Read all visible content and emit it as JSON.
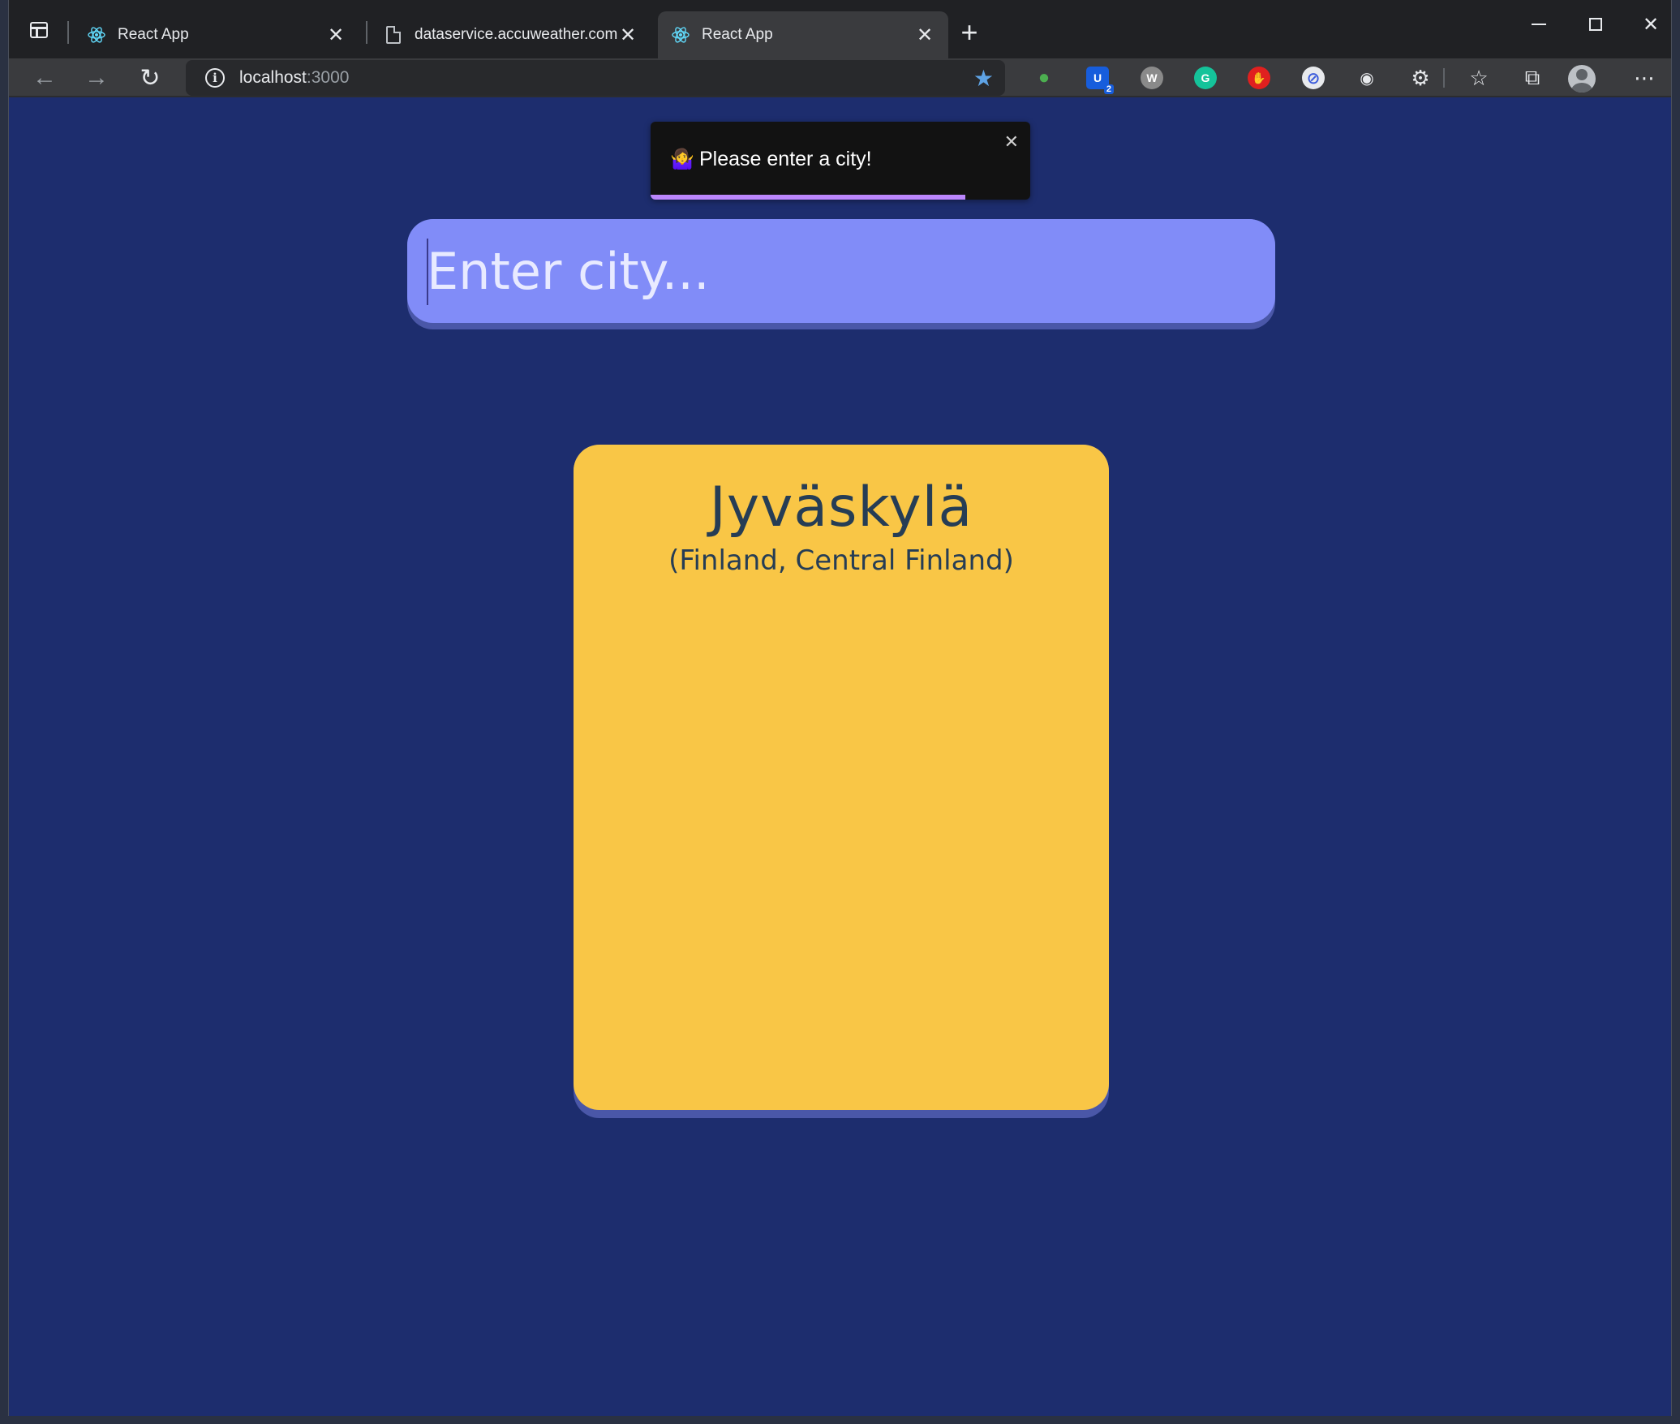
{
  "browser": {
    "tabs": [
      {
        "title": "React App",
        "icon": "react-icon",
        "active": false
      },
      {
        "title": "dataservice.accuweather.com/fo",
        "icon": "document-icon",
        "active": false
      },
      {
        "title": "React App",
        "icon": "react-icon",
        "active": true
      }
    ],
    "address": {
      "host": "localhost",
      "port": ":3000"
    },
    "extensions": [
      {
        "name": "globe-extension-icon",
        "color": "#3a9b3a",
        "glyph": "●"
      },
      {
        "name": "bitwarden-icon",
        "color": "#175ddc",
        "glyph": "U",
        "badge": "2"
      },
      {
        "name": "w-extension-icon",
        "color": "#8a8a8a",
        "glyph": "W"
      },
      {
        "name": "grammarly-icon",
        "color": "#15c39a",
        "glyph": "G"
      },
      {
        "name": "adblock-icon",
        "color": "#e0201f",
        "glyph": "✋"
      },
      {
        "name": "block-icon",
        "color": "#3b5bdb",
        "glyph": "⊘"
      },
      {
        "name": "screenshot-icon",
        "color": "#3a3b3e",
        "glyph": "◉"
      }
    ]
  },
  "toast": {
    "emoji": "🤷‍♀️",
    "message": "Please enter a city!",
    "progress": 0.83,
    "accent": "#bb86fc"
  },
  "search": {
    "placeholder": "Enter city...",
    "value": ""
  },
  "weather_card": {
    "city": "Jyväskylä",
    "region": "(Finland, Central Finland)",
    "background": "#f9c646"
  },
  "colors": {
    "page_background": "#1d2d6e",
    "input_background": "#818cf8",
    "text_dark": "#263d55"
  }
}
